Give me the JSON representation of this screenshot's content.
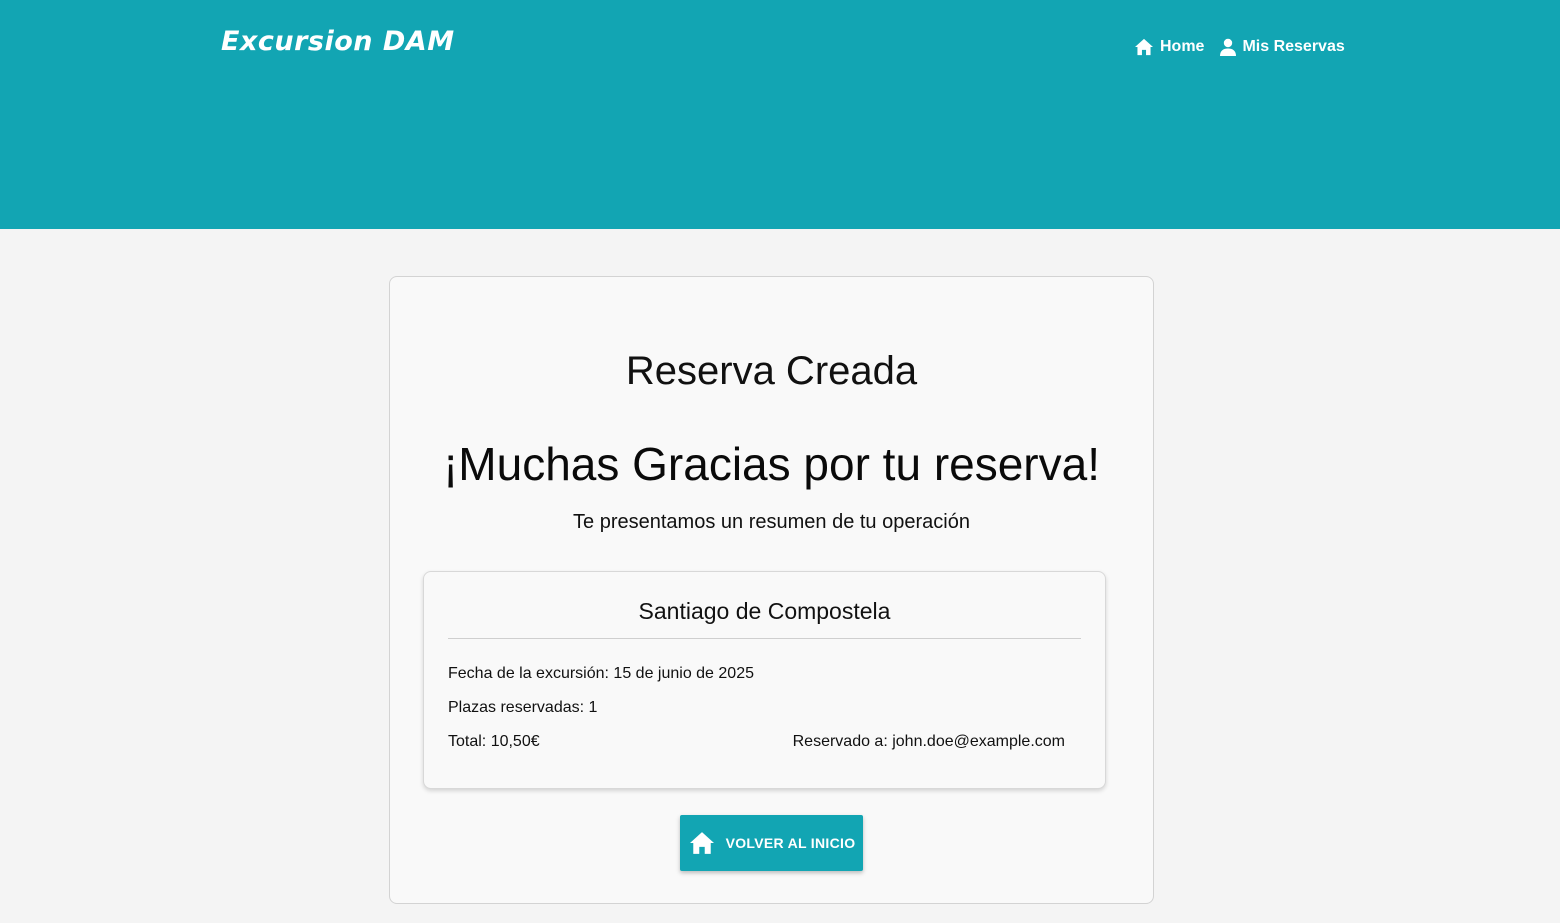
{
  "header": {
    "brand": "Excursion DAM",
    "nav": {
      "home_label": "Home",
      "home_icon": "home-icon",
      "reservations_label": "Mis Reservas",
      "reservations_icon": "user-icon"
    },
    "background_color": "#12a5b3"
  },
  "main": {
    "title": "Reserva Creada",
    "thanks": "¡Muchas Gracias por tu reserva!",
    "subtitle": "Te presentamos un resumen de tu operación",
    "summary": {
      "destination": "Santiago de Compostela",
      "date_line": "Fecha de la excursión: 15 de junio de 2025",
      "seats_line": "Plazas reservadas: 1",
      "total_line": "Total: 10,50€",
      "email_line": "Reservado a: john.doe@example.com"
    },
    "back_button": {
      "label": "VOLVER AL INICIO",
      "icon": "home-icon"
    }
  },
  "colors": {
    "accent": "#12a5b3",
    "page_background": "#f4f4f4",
    "card_background": "#f9f9f9"
  }
}
